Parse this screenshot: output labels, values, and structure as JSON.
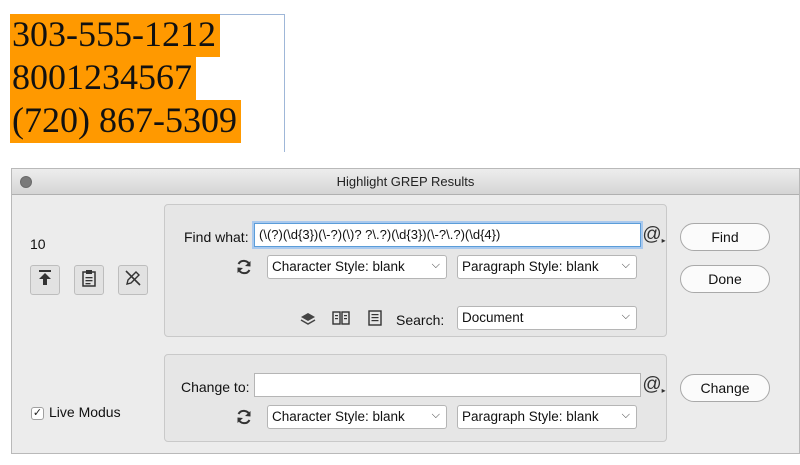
{
  "document": {
    "lines": [
      "303-555-1212",
      "8001234567",
      "(720) 867-5309"
    ],
    "highlight_color": "#ff9900"
  },
  "dialog": {
    "title": "Highlight GREP Results",
    "result_count": "10",
    "find": {
      "label": "Find what:",
      "value": "(\\(?)(\\d{3})(\\-?)(\\)? ?\\.?)(\\d{3})(\\-?\\.?)(\\d{4})"
    },
    "find_styles": {
      "character_style": "Character Style: blank",
      "paragraph_style": "Paragraph Style: blank"
    },
    "search": {
      "label": "Search:",
      "value": "Document"
    },
    "change": {
      "label": "Change to:",
      "value": ""
    },
    "change_styles": {
      "character_style": "Character Style: blank",
      "paragraph_style": "Paragraph Style: blank"
    },
    "buttons": {
      "find": "Find",
      "done": "Done",
      "change": "Change"
    },
    "live_mode": {
      "label": "Live Modus",
      "checked": true
    },
    "special_char_glyph": "@",
    "icons": [
      "jump-to-icon",
      "clipboard-icon",
      "no-edit-icon",
      "refresh-icon",
      "layers-icon",
      "book-icon",
      "document-icon",
      "at-special-icon"
    ]
  }
}
